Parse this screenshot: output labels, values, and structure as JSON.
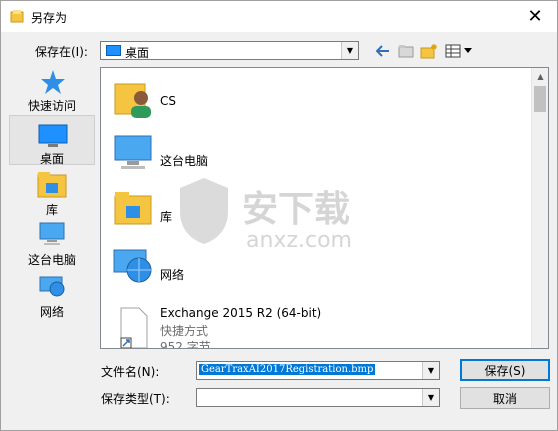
{
  "window": {
    "title": "另存为"
  },
  "toolbar": {
    "save_in_label": "保存在(I):",
    "save_in_value": "桌面"
  },
  "places": [
    {
      "label": "快速访问",
      "icon": "star-icon"
    },
    {
      "label": "桌面",
      "icon": "desktop-icon",
      "active": true
    },
    {
      "label": "库",
      "icon": "library-icon"
    },
    {
      "label": "这台电脑",
      "icon": "computer-icon"
    },
    {
      "label": "网络",
      "icon": "network-icon"
    }
  ],
  "files": [
    {
      "name": "CS",
      "icon": "user-folder-icon"
    },
    {
      "name": "这台电脑",
      "icon": "computer-icon"
    },
    {
      "name": "库",
      "icon": "library-icon"
    },
    {
      "name": "网络",
      "icon": "network-icon"
    },
    {
      "name": "Exchange 2015 R2 (64-bit)",
      "type": "快捷方式",
      "size": "952 字节",
      "icon": "shortcut-icon"
    }
  ],
  "form": {
    "filename_label": "文件名(N):",
    "filename_value": "GearTraxAI2017Registration.bmp",
    "filetype_label": "保存类型(T):",
    "filetype_value": ""
  },
  "buttons": {
    "save": "保存(S)",
    "cancel": "取消"
  },
  "watermark": {
    "text": "安下载",
    "sub": "anxz.com"
  },
  "colors": {
    "accent": "#0078d7",
    "folder": "#f5c542",
    "monitor": "#1e90ff"
  }
}
